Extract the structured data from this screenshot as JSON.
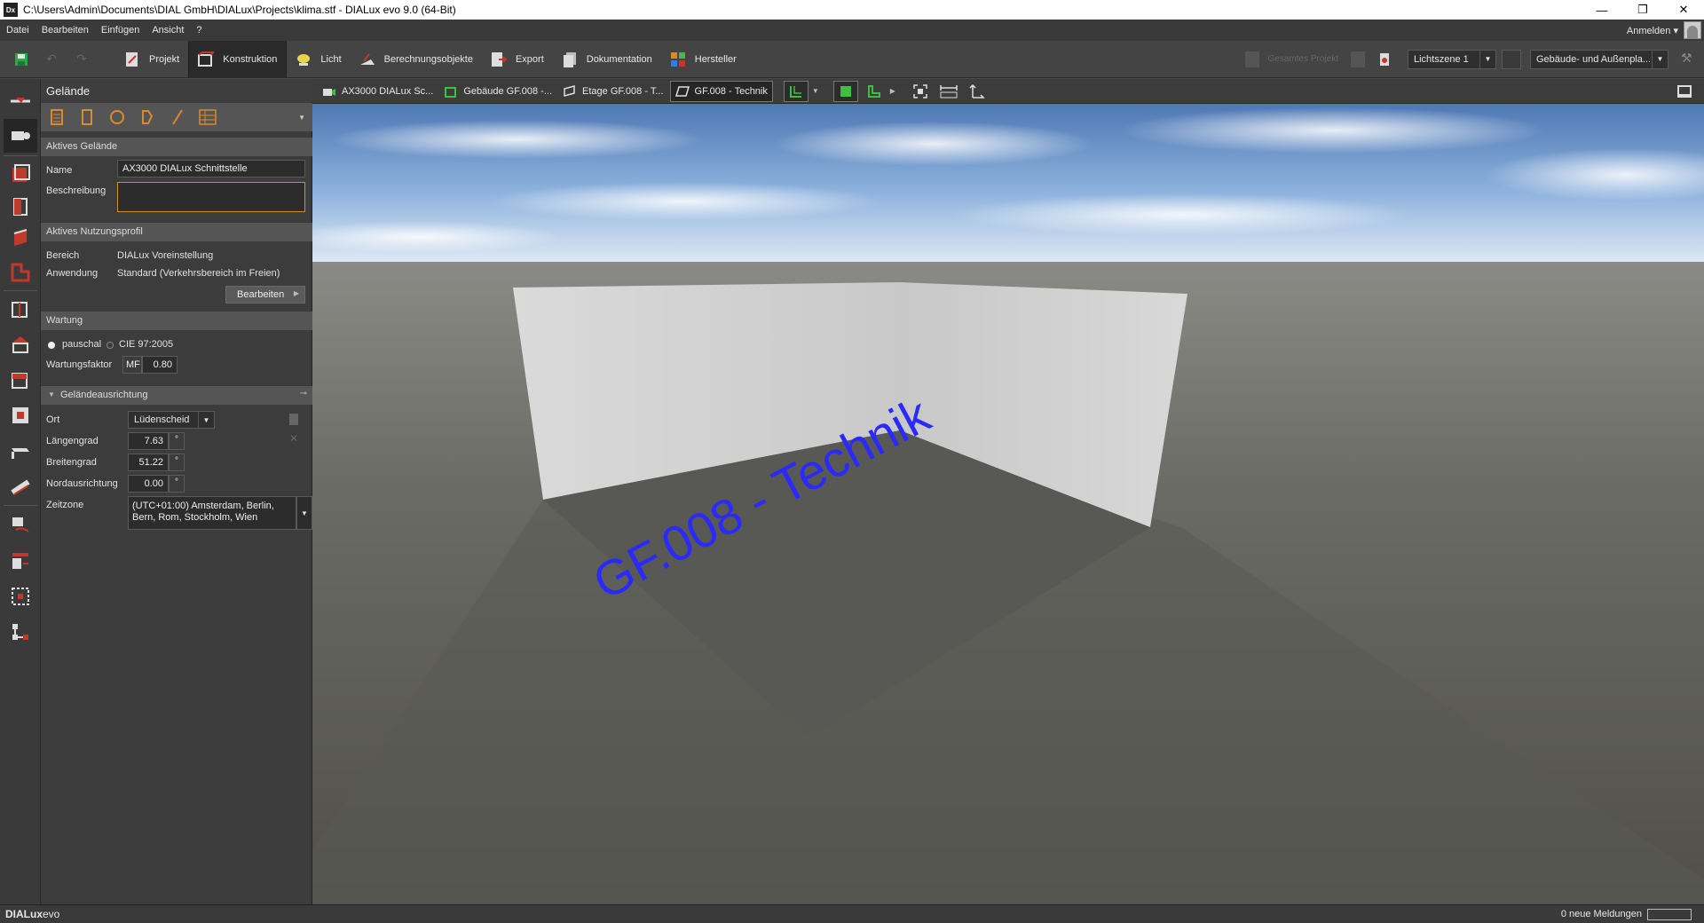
{
  "window": {
    "title": "C:\\Users\\Admin\\Documents\\DIAL GmbH\\DIALux\\Projects\\klima.stf - DIALux evo 9.0  (64-Bit)",
    "app_icon": "Dx",
    "minimize": "—",
    "restore": "❐",
    "close": "✕"
  },
  "menu": {
    "items": [
      "Datei",
      "Bearbeiten",
      "Einfügen",
      "Ansicht",
      "?"
    ],
    "login": "Anmelden"
  },
  "toolbar": {
    "tabs": [
      "Projekt",
      "Konstruktion",
      "Licht",
      "Berechnungsobjekte",
      "Export",
      "Dokumentation",
      "Hersteller"
    ],
    "active_tab": "Konstruktion",
    "calc_button": "Gesamtes Projekt",
    "lightscene": "Lichtszene 1",
    "view_select": "Gebäude- und Außenpla..."
  },
  "panel": {
    "title": "Gelände",
    "active_site": {
      "header": "Aktives Gelände",
      "name_label": "Name",
      "name_value": "AX3000 DIALux Schnittstelle",
      "desc_label": "Beschreibung",
      "desc_value": ""
    },
    "usage_profile": {
      "header": "Aktives Nutzungsprofil",
      "area_label": "Bereich",
      "area_value": "DIALux Voreinstellung",
      "application_label": "Anwendung",
      "application_value": "Standard (Verkehrsbereich im Freien)",
      "edit_button": "Bearbeiten"
    },
    "maintenance": {
      "header": "Wartung",
      "option_pauschal": "pauschal",
      "option_cie": "CIE 97:2005",
      "factor_label": "Wartungsfaktor",
      "factor_prefix": "MF",
      "factor_value": "0.80"
    },
    "orientation": {
      "header": "Geländeausrichtung",
      "place_label": "Ort",
      "place_value": "Lüdenscheid",
      "longitude_label": "Längengrad",
      "longitude_value": "7.63",
      "latitude_label": "Breitengrad",
      "latitude_value": "51.22",
      "north_label": "Nordausrichtung",
      "north_value": "0.00",
      "degree_unit": "°",
      "timezone_label": "Zeitzone",
      "timezone_line1": "(UTC+01:00) Amsterdam, Berlin,",
      "timezone_line2": "Bern, Rom, Stockholm, Wien"
    }
  },
  "view_tabs": [
    {
      "label": "AX3000 DIALux Sc..."
    },
    {
      "label": "Gebäude GF.008 -..."
    },
    {
      "label": "Etage GF.008 - T..."
    },
    {
      "label": "GF.008 - Technik"
    }
  ],
  "scene": {
    "floor_label": "GF.008 - Technik"
  },
  "status": {
    "logo_bold": "DIALux",
    "logo_rest": "evo",
    "messages": "0 neue Meldungen"
  },
  "colors": {
    "accent_orange": "#d98a2b",
    "accent_red": "#c0392b",
    "accent_green": "#3fbf3f",
    "floor_text_blue": "#2a2aff"
  }
}
